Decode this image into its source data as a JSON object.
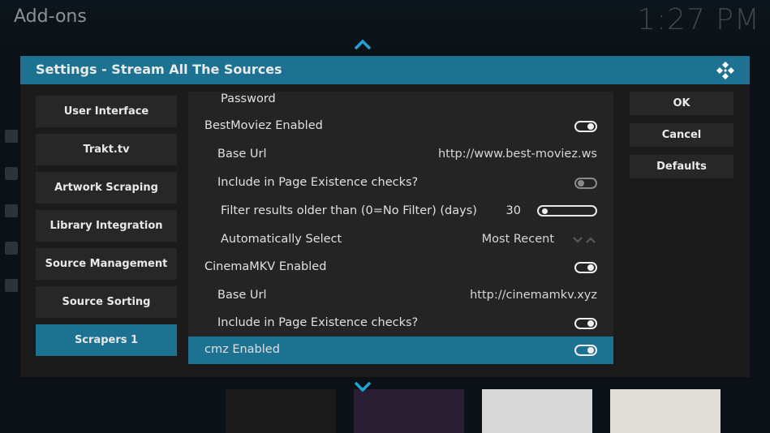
{
  "background": {
    "title": "Add-ons",
    "clock": "1:27 PM"
  },
  "dialog": {
    "title": "Settings - Stream All The Sources",
    "categories": [
      {
        "label": "User Interface",
        "active": false
      },
      {
        "label": "Trakt.tv",
        "active": false
      },
      {
        "label": "Artwork Scraping",
        "active": false
      },
      {
        "label": "Library Integration",
        "active": false
      },
      {
        "label": "Source Management",
        "active": false
      },
      {
        "label": "Source Sorting",
        "active": false
      },
      {
        "label": "Scrapers 1",
        "active": true
      }
    ],
    "settings": [
      {
        "label": "Password"
      },
      {
        "label": "BestMoviez Enabled",
        "toggle": "on"
      },
      {
        "label": "Base Url",
        "value": "http://www.best-moviez.ws"
      },
      {
        "label": "Include in Page Existence checks?",
        "toggle": "off"
      },
      {
        "label": "Filter results older than (0=No Filter) (days)",
        "value": "30"
      },
      {
        "label": "Automatically Select",
        "value": "Most Recent"
      },
      {
        "label": "CinemaMKV Enabled",
        "toggle": "on"
      },
      {
        "label": "Base Url",
        "value": "http://cinemamkv.xyz"
      },
      {
        "label": "Include in Page Existence checks?",
        "toggle": "on"
      },
      {
        "label": "cmz Enabled",
        "toggle": "on",
        "active": true
      }
    ],
    "buttons": {
      "ok": "OK",
      "cancel": "Cancel",
      "defaults": "Defaults"
    }
  },
  "colors": {
    "accent": "#1c7290",
    "panel": "#242424",
    "button": "#272727"
  }
}
